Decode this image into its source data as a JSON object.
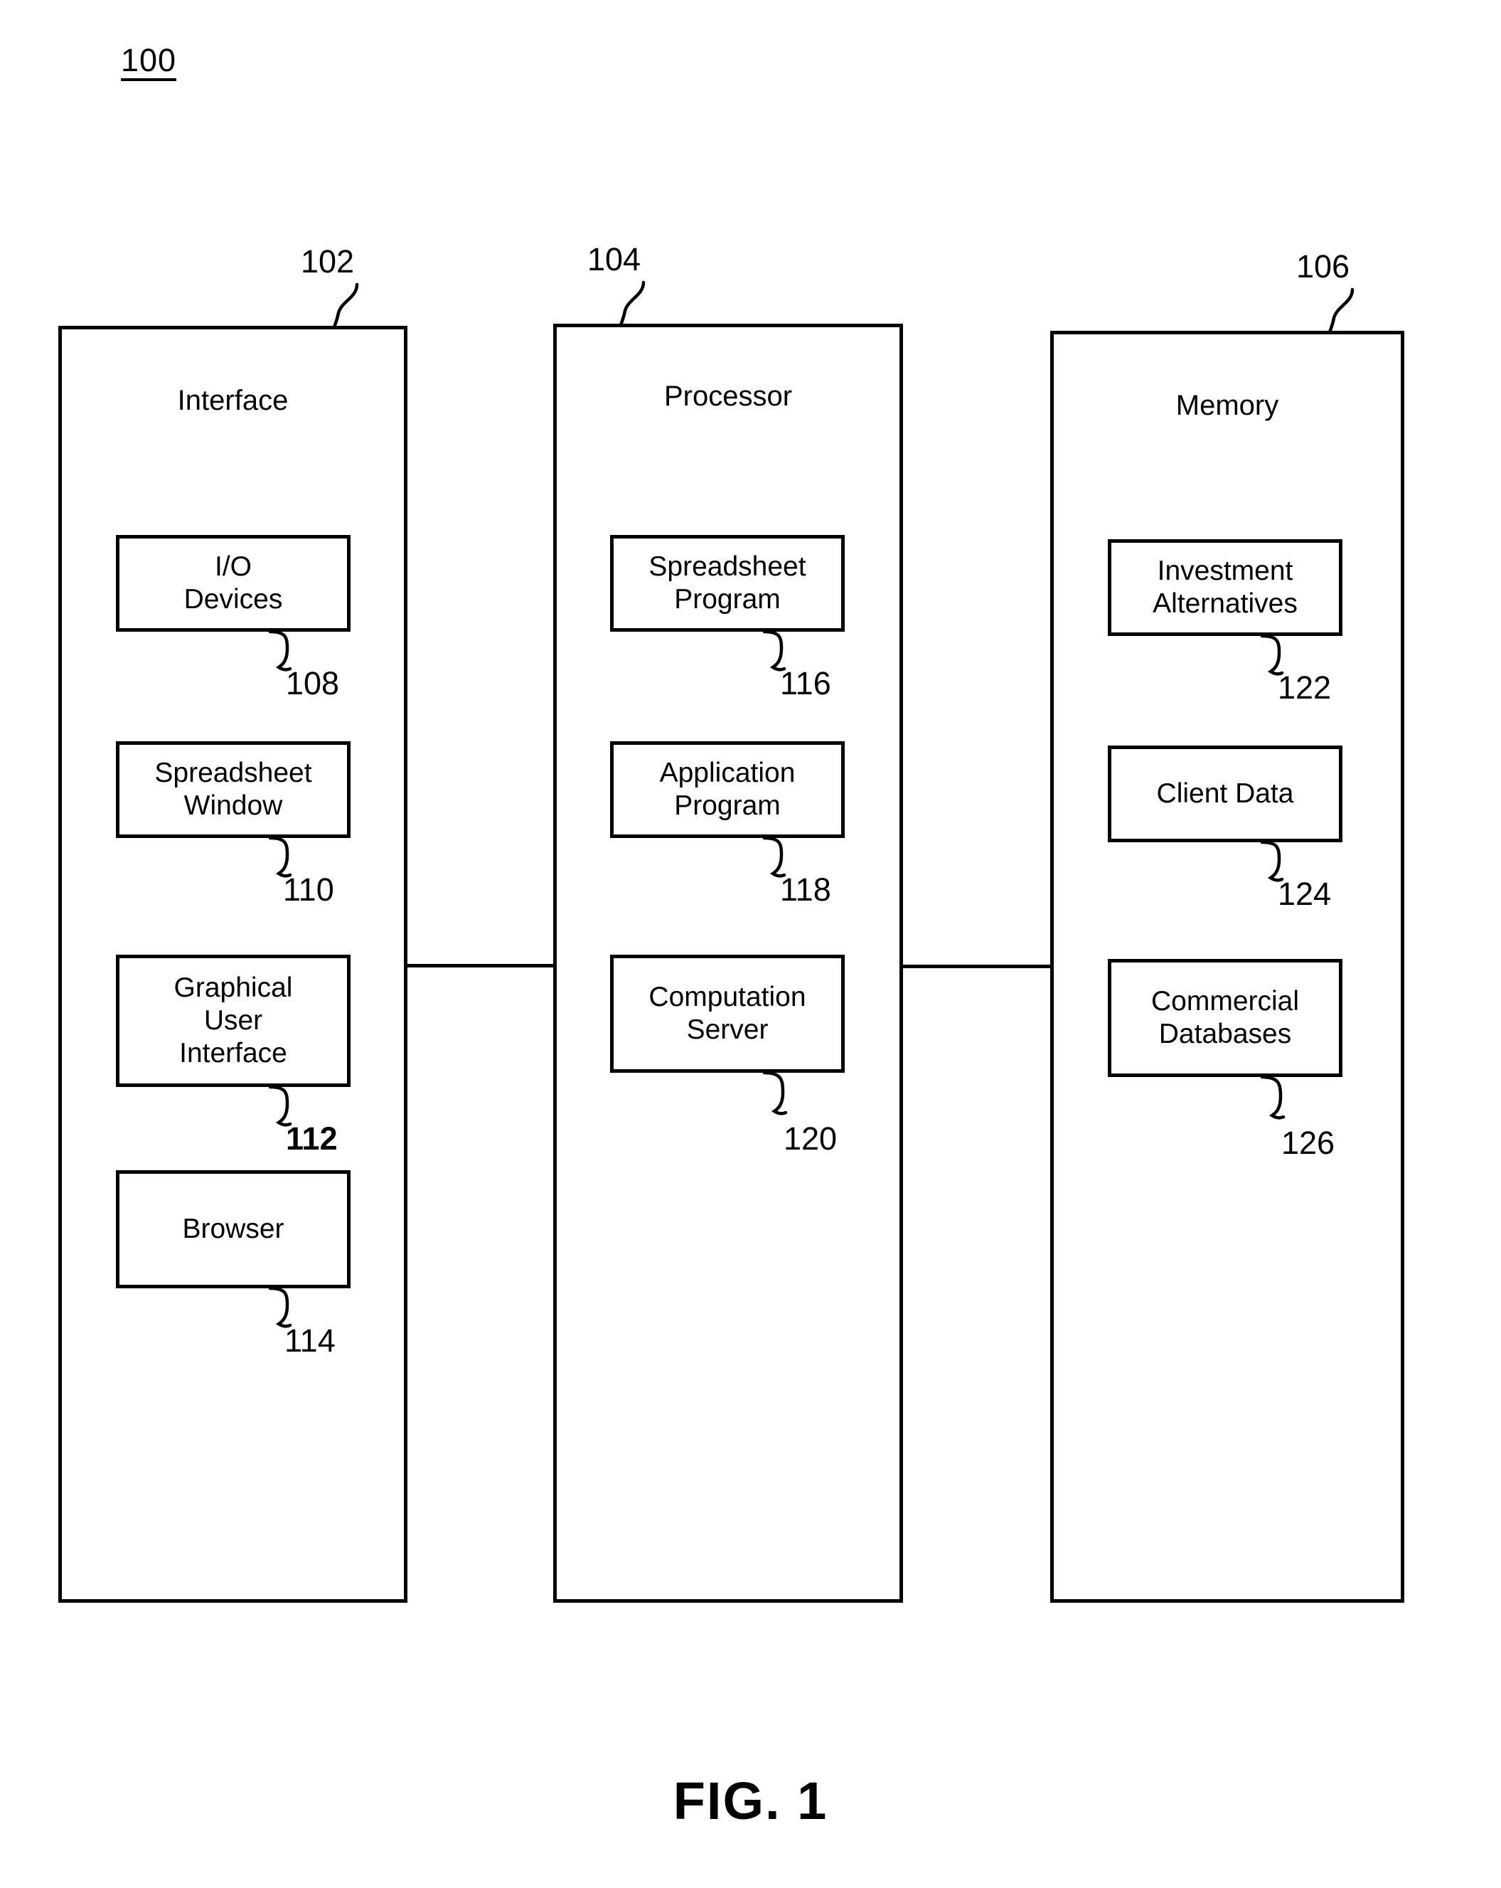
{
  "figure": {
    "system_ref": "100",
    "caption": "FIG. 1"
  },
  "columns": [
    {
      "ref": "102",
      "title": "Interface",
      "boxes": [
        {
          "label": "I/O\nDevices",
          "ref": "108",
          "ref_bold": false
        },
        {
          "label": "Spreadsheet\nWindow",
          "ref": "110",
          "ref_bold": false
        },
        {
          "label": "Graphical\nUser\nInterface",
          "ref": "112",
          "ref_bold": true
        },
        {
          "label": "Browser",
          "ref": "114",
          "ref_bold": false
        }
      ]
    },
    {
      "ref": "104",
      "title": "Processor",
      "boxes": [
        {
          "label": "Spreadsheet\nProgram",
          "ref": "116",
          "ref_bold": false
        },
        {
          "label": "Application\nProgram",
          "ref": "118",
          "ref_bold": false
        },
        {
          "label": "Computation\nServer",
          "ref": "120",
          "ref_bold": false
        }
      ]
    },
    {
      "ref": "106",
      "title": "Memory",
      "boxes": [
        {
          "label": "Investment\nAlternatives",
          "ref": "122",
          "ref_bold": false
        },
        {
          "label": "Client Data",
          "ref": "124",
          "ref_bold": false
        },
        {
          "label": "Commercial\nDatabases",
          "ref": "126",
          "ref_bold": false
        }
      ]
    }
  ]
}
